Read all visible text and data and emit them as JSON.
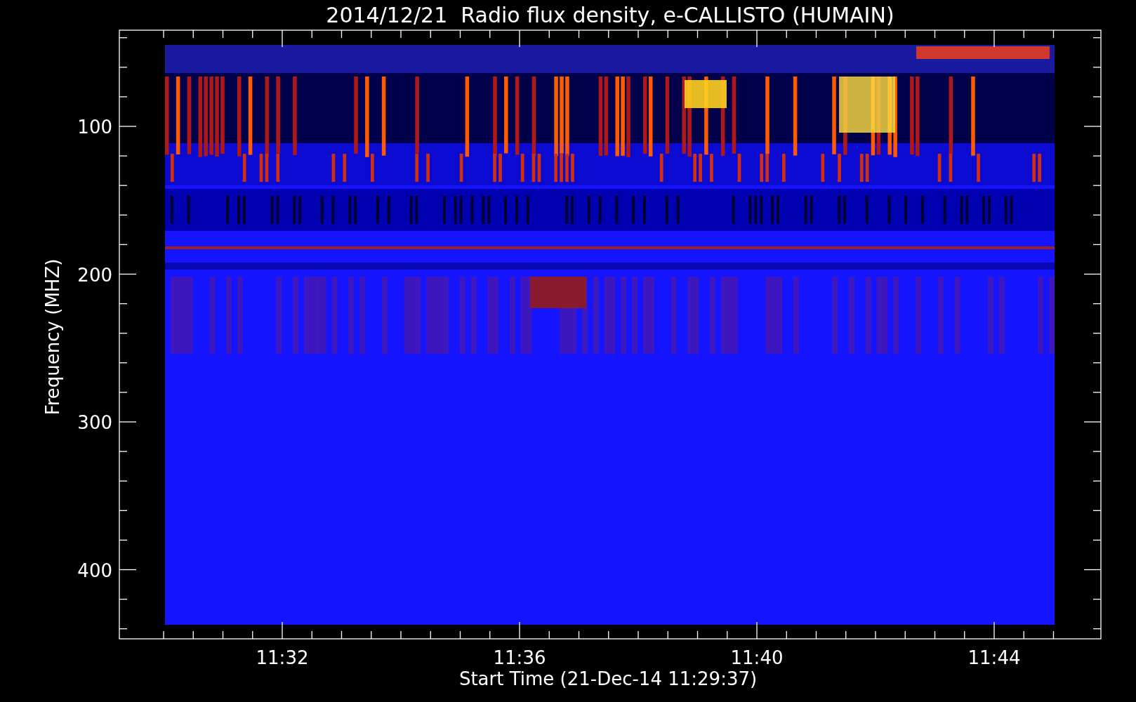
{
  "title": "2014/12/21  Radio flux density, e-CALLISTO (HUMAIN)",
  "y_axis": {
    "label": "Frequency (MHZ)",
    "ticks": [
      "100",
      "200",
      "300",
      "400"
    ]
  },
  "x_axis": {
    "label": "Start Time (21-Dec-14 11:29:37)",
    "ticks": [
      "11:32",
      "11:36",
      "11:40",
      "11:44"
    ]
  }
}
